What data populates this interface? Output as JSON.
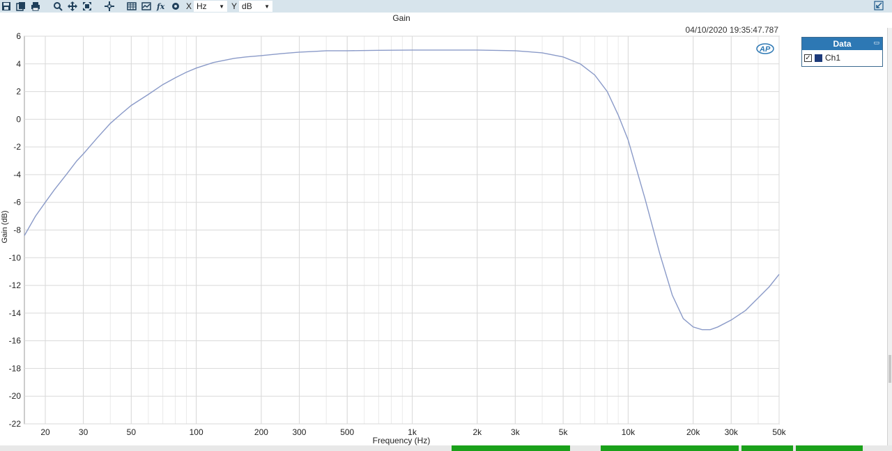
{
  "toolbar": {
    "x_axis_label": "X",
    "x_unit": "Hz",
    "y_axis_label": "Y",
    "y_unit": "dB"
  },
  "timestamp": "04/10/2020 19:35:47.787",
  "legend": {
    "title": "Data",
    "entries": [
      {
        "name": "Ch1",
        "checked": true,
        "color": "#1d3a7a"
      }
    ]
  },
  "colors": {
    "trace": "#8a9ac8",
    "grid": "#d9d9d9",
    "toolbar_bg": "#d7e4ec",
    "legend_header": "#2d78b4",
    "status_green": "#1aa11a"
  },
  "chart_data": {
    "type": "line",
    "title": "Gain",
    "xlabel": "Frequency (Hz)",
    "ylabel": "Gain (dB)",
    "x_scale": "log",
    "xlim": [
      16,
      50000
    ],
    "ylim": [
      -22,
      6
    ],
    "grid": true,
    "legend_placement": "top-right outside",
    "x_ticks": [
      {
        "value": 20,
        "label": "20"
      },
      {
        "value": 30,
        "label": "30"
      },
      {
        "value": 50,
        "label": "50"
      },
      {
        "value": 100,
        "label": "100"
      },
      {
        "value": 200,
        "label": "200"
      },
      {
        "value": 300,
        "label": "300"
      },
      {
        "value": 500,
        "label": "500"
      },
      {
        "value": 1000,
        "label": "1k"
      },
      {
        "value": 2000,
        "label": "2k"
      },
      {
        "value": 3000,
        "label": "3k"
      },
      {
        "value": 5000,
        "label": "5k"
      },
      {
        "value": 10000,
        "label": "10k"
      },
      {
        "value": 20000,
        "label": "20k"
      },
      {
        "value": 30000,
        "label": "30k"
      },
      {
        "value": 50000,
        "label": "50k"
      }
    ],
    "y_ticks": [
      6,
      4,
      2,
      0,
      -2,
      -4,
      -6,
      -8,
      -10,
      -12,
      -14,
      -16,
      -18,
      -20,
      -22
    ],
    "series": [
      {
        "name": "Ch1",
        "x": [
          16,
          18,
          20,
          22,
          25,
          28,
          30,
          35,
          40,
          45,
          50,
          60,
          70,
          80,
          90,
          100,
          120,
          150,
          170,
          200,
          250,
          300,
          350,
          400,
          500,
          700,
          1000,
          1500,
          2000,
          3000,
          4000,
          5000,
          6000,
          7000,
          8000,
          9000,
          10000,
          12000,
          14000,
          16000,
          18000,
          20000,
          22000,
          24000,
          26000,
          30000,
          35000,
          40000,
          45000,
          50000
        ],
        "y": [
          -8.4,
          -7.0,
          -6.0,
          -5.1,
          -4.0,
          -3.0,
          -2.5,
          -1.3,
          -0.3,
          0.4,
          1.0,
          1.8,
          2.5,
          3.0,
          3.4,
          3.7,
          4.1,
          4.4,
          4.5,
          4.6,
          4.75,
          4.85,
          4.9,
          4.95,
          4.95,
          4.98,
          5.0,
          5.0,
          5.0,
          4.95,
          4.8,
          4.5,
          4.0,
          3.2,
          2.0,
          0.3,
          -1.5,
          -5.8,
          -9.7,
          -12.7,
          -14.4,
          -15.0,
          -15.2,
          -15.2,
          -15.0,
          -14.5,
          -13.8,
          -12.9,
          -12.1,
          -11.2
        ]
      }
    ]
  }
}
